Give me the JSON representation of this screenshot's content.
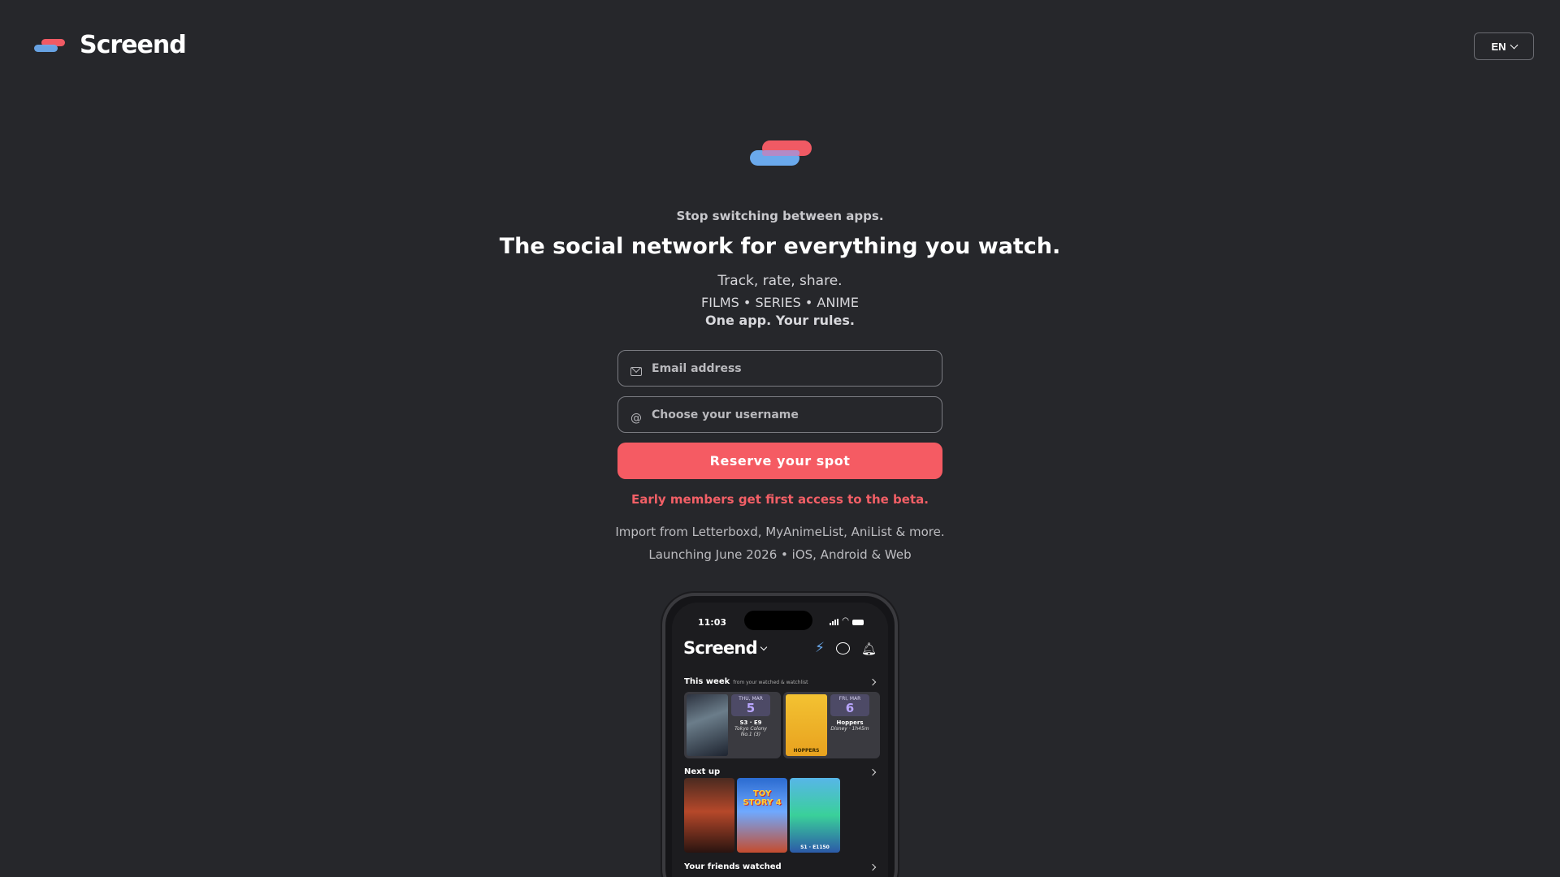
{
  "header": {
    "brand": "Screend",
    "language": "EN"
  },
  "hero": {
    "tagline": "Stop switching between apps.",
    "headline": "The social network for everything you watch.",
    "sub1": "Track, rate, share.",
    "sub2": "FILMS • SERIES • ANIME",
    "sub3": "One app. Your rules."
  },
  "form": {
    "email_placeholder": "Email address",
    "username_placeholder": "Choose your username",
    "username_icon": "@",
    "submit_label": "Reserve your spot"
  },
  "notes": {
    "early": "Early members get first access to the beta.",
    "import": "Import from Letterboxd, MyAnimeList, AniList & more.",
    "launch": "Launching June 2026 • iOS, Android & Web"
  },
  "phone": {
    "time": "11:03",
    "app_title": "Screend",
    "this_week_title": "This week",
    "this_week_sub": "from your watched & watchlist",
    "cards": [
      {
        "dow": "THU, MAR",
        "day": "5",
        "ep": "S3 · E9",
        "desc": "Tokyo Colony No.1 (3)"
      },
      {
        "dow": "FRI, MAR",
        "day": "6",
        "ep": "Hoppers",
        "desc": "Disney · 1h45m",
        "poster_label": "HOPPERS"
      }
    ],
    "next_up_title": "Next up",
    "next_up": [
      {
        "label": ""
      },
      {
        "title": "TOY STORY 4"
      },
      {
        "label": "S1 · E1150"
      }
    ],
    "friends_title": "Your friends watched"
  },
  "colors": {
    "background": "#26272b",
    "accent_red": "#f55b63",
    "accent_blue": "#6aa9ec"
  }
}
